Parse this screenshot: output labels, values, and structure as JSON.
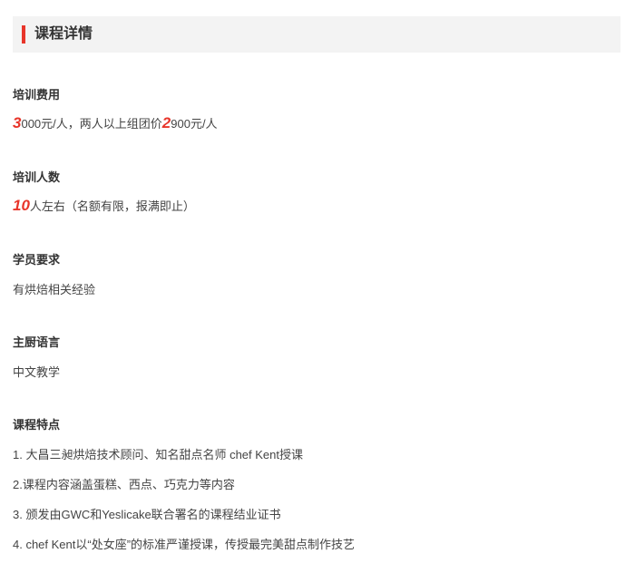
{
  "header": {
    "title": "课程详情",
    "accent_color": "#e8352a",
    "background_color": "#f3f3f3"
  },
  "fee": {
    "label": "培训费用",
    "price1_big": "3",
    "price1_rest": "000元/人，两人以上组团价",
    "price2_big": "2",
    "price2_rest": "900元/人"
  },
  "capacity": {
    "label": "培训人数",
    "count_big": "10",
    "count_rest": "人左右（名额有限，报满即止）"
  },
  "requirement": {
    "label": "学员要求",
    "value": "有烘焙相关经验"
  },
  "language": {
    "label": "主厨语言",
    "value": "中文教学"
  },
  "features": {
    "label": "课程特点",
    "items": [
      "1. 大昌三昶烘焙技术顾问、知名甜点名师 chef Kent授课",
      "2.课程内容涵盖蛋糕、西点、巧克力等内容",
      "3. 颁发由GWC和Yeslicake联合署名的课程结业证书",
      "4. chef Kent以“处女座”的标准严谨授课，传授最完美甜点制作技艺"
    ]
  }
}
